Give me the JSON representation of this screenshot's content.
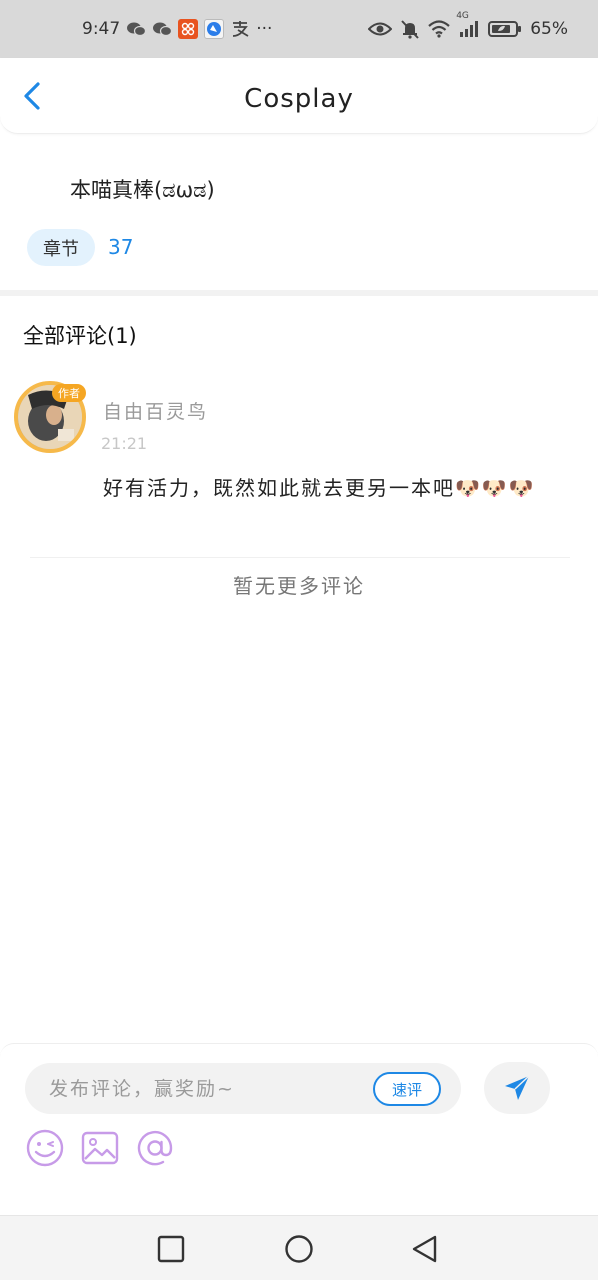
{
  "status_bar": {
    "time": "9:47",
    "battery": "65%",
    "network": "4G",
    "more": "···",
    "left_icons": [
      "wechat-icon",
      "wechat-icon",
      "app-red-icon",
      "app-blue-icon",
      "alipay-icon"
    ],
    "right_icons": [
      "eye-icon",
      "mute-bell-icon",
      "wifi-icon",
      "signal-icon",
      "battery-icon"
    ]
  },
  "header": {
    "title": "Cosplay"
  },
  "work": {
    "subtitle": "本喵真棒(ಡωಡ)",
    "chapter_label": "章节",
    "chapter_count": "37"
  },
  "comments": {
    "heading": "全部评论(1)",
    "items": [
      {
        "author": "自由百灵鸟",
        "author_badge": "作者",
        "time": "21:21",
        "text": "好有活力，既然如此就去更另一本吧🐶🐶🐶"
      }
    ],
    "no_more": "暂无更多评论"
  },
  "composer": {
    "placeholder": "发布评论，赢奖励~",
    "quick_comment_label": "速评",
    "tools": [
      "emoji-icon",
      "image-icon",
      "mention-icon"
    ]
  },
  "colors": {
    "accent": "#1e88e5",
    "pill_bg": "#e3f2fd",
    "tool_purple": "#c79be8",
    "status_bar_bg": "#d9d9d9"
  }
}
